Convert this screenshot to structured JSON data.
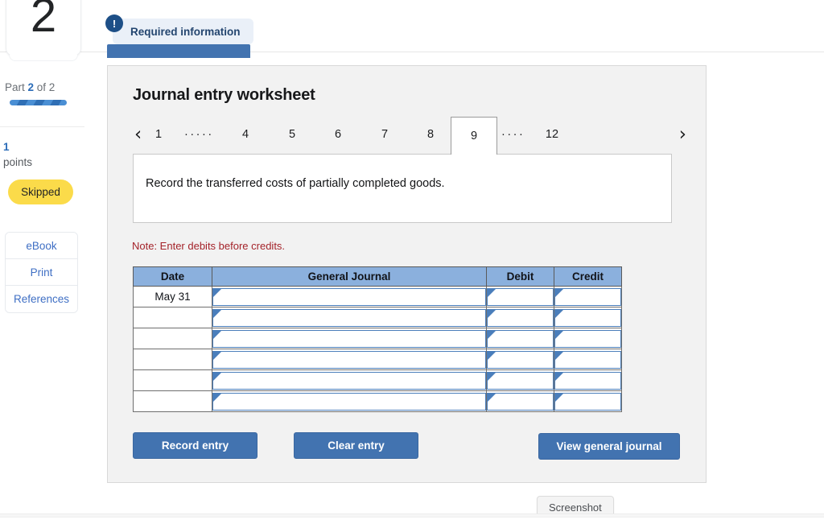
{
  "sidebar": {
    "question_number": "2",
    "part_prefix": "Part ",
    "part_current": "2",
    "part_suffix": " of 2",
    "points_value": "1",
    "points_label": "points",
    "status_badge": "Skipped",
    "links": [
      {
        "label": "eBook"
      },
      {
        "label": "Print"
      },
      {
        "label": "References"
      }
    ]
  },
  "banner": {
    "badge_icon": "!",
    "label": "Required information"
  },
  "panel": {
    "title": "Journal entry worksheet",
    "prompt": "Record the transferred costs of partially completed goods.",
    "note": "Note: Enter debits before credits."
  },
  "pager": {
    "prev_icon": "‹",
    "next_icon": "›",
    "items": [
      {
        "type": "num",
        "label": "1"
      },
      {
        "type": "dots",
        "label": "·····"
      },
      {
        "type": "num",
        "label": "4"
      },
      {
        "type": "num",
        "label": "5"
      },
      {
        "type": "num",
        "label": "6"
      },
      {
        "type": "num",
        "label": "7"
      },
      {
        "type": "num",
        "label": "8"
      },
      {
        "type": "active",
        "label": "9"
      },
      {
        "type": "dots",
        "label": "····"
      },
      {
        "type": "num",
        "label": "12"
      }
    ]
  },
  "table": {
    "headers": [
      "Date",
      "General Journal",
      "Debit",
      "Credit"
    ],
    "rows": [
      {
        "date": "May 31",
        "general_journal": "",
        "debit": "",
        "credit": ""
      },
      {
        "date": "",
        "general_journal": "",
        "debit": "",
        "credit": ""
      },
      {
        "date": "",
        "general_journal": "",
        "debit": "",
        "credit": ""
      },
      {
        "date": "",
        "general_journal": "",
        "debit": "",
        "credit": ""
      },
      {
        "date": "",
        "general_journal": "",
        "debit": "",
        "credit": ""
      },
      {
        "date": "",
        "general_journal": "",
        "debit": "",
        "credit": ""
      }
    ]
  },
  "actions": {
    "record_entry": "Record entry",
    "clear_entry": "Clear entry",
    "view_general_journal": "View general journal"
  },
  "tooltip": {
    "label": "Screenshot"
  },
  "colors": {
    "accent_blue": "#4273b0",
    "link_blue": "#3f6fc4",
    "header_blue": "#8bb0dd",
    "badge_yellow": "#fbdb4a",
    "note_red": "#a4232a",
    "panel_bg": "#f2f2f2"
  }
}
